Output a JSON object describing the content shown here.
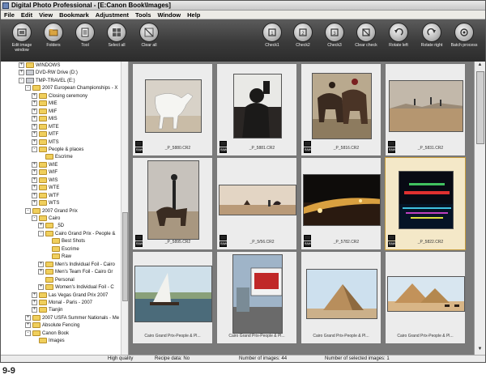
{
  "window": {
    "title": "Digital Photo Professional - [E:Canon Book\\Images]"
  },
  "menu": [
    "File",
    "Edit",
    "View",
    "Bookmark",
    "Adjustment",
    "Tools",
    "Window",
    "Help"
  ],
  "toolbar": {
    "left": [
      {
        "label": "Edit image window",
        "icon": "edit-image-icon"
      },
      {
        "label": "Folders",
        "icon": "folders-icon"
      },
      {
        "label": "Tool",
        "icon": "tool-icon"
      },
      {
        "label": "Select all",
        "icon": "select-all-icon"
      },
      {
        "label": "Clear all",
        "icon": "clear-all-icon"
      }
    ],
    "right": [
      {
        "label": "Check1",
        "icon": "check1-icon"
      },
      {
        "label": "Check2",
        "icon": "check2-icon"
      },
      {
        "label": "Check3",
        "icon": "check3-icon"
      },
      {
        "label": "Clear check",
        "icon": "clear-check-icon"
      },
      {
        "label": "Rotate left",
        "icon": "rotate-left-icon"
      },
      {
        "label": "Rotate right",
        "icon": "rotate-right-icon"
      },
      {
        "label": "Batch process",
        "icon": "batch-process-icon"
      }
    ]
  },
  "tree": [
    {
      "label": "WINDOWS",
      "exp": "+",
      "kind": "folder",
      "level": 1
    },
    {
      "label": "DVD-RW Drive (D:)",
      "exp": "+",
      "kind": "drive",
      "level": 1
    },
    {
      "label": "TMP-TRAVEL (E:)",
      "exp": "-",
      "kind": "drive",
      "level": 1
    },
    {
      "label": "2007 European Championships - X",
      "exp": "-",
      "kind": "folder",
      "level": 2
    },
    {
      "label": "Closing ceremony",
      "exp": "+",
      "kind": "folder",
      "level": 3
    },
    {
      "label": "MIE",
      "exp": "+",
      "kind": "folder",
      "level": 3
    },
    {
      "label": "MIF",
      "exp": "+",
      "kind": "folder",
      "level": 3
    },
    {
      "label": "MIS",
      "exp": "+",
      "kind": "folder",
      "level": 3
    },
    {
      "label": "MTE",
      "exp": "+",
      "kind": "folder",
      "level": 3
    },
    {
      "label": "MTF",
      "exp": "+",
      "kind": "folder",
      "level": 3
    },
    {
      "label": "MTS",
      "exp": "+",
      "kind": "folder",
      "level": 3
    },
    {
      "label": "People & places",
      "exp": "-",
      "kind": "folder",
      "level": 3
    },
    {
      "label": "Escrime",
      "exp": "",
      "kind": "folder",
      "level": 4
    },
    {
      "label": "WIE",
      "exp": "+",
      "kind": "folder",
      "level": 3
    },
    {
      "label": "WIF",
      "exp": "+",
      "kind": "folder",
      "level": 3
    },
    {
      "label": "WIS",
      "exp": "+",
      "kind": "folder",
      "level": 3
    },
    {
      "label": "WTE",
      "exp": "+",
      "kind": "folder",
      "level": 3
    },
    {
      "label": "WTF",
      "exp": "+",
      "kind": "folder",
      "level": 3
    },
    {
      "label": "WTS",
      "exp": "+",
      "kind": "folder",
      "level": 3
    },
    {
      "label": "2007 Grand Prix",
      "exp": "-",
      "kind": "folder",
      "level": 2
    },
    {
      "label": "Cairo",
      "exp": "-",
      "kind": "folder",
      "level": 3
    },
    {
      "label": "_5D",
      "exp": "+",
      "kind": "folder",
      "level": 4
    },
    {
      "label": "Cairo Grand Prix - People &",
      "exp": "-",
      "kind": "folder",
      "level": 4
    },
    {
      "label": "Best Shots",
      "exp": "",
      "kind": "folder",
      "level": 5
    },
    {
      "label": "Escrime",
      "exp": "",
      "kind": "folder",
      "level": 5
    },
    {
      "label": "Raw",
      "exp": "",
      "kind": "folder",
      "level": 5
    },
    {
      "label": "Men's Individual Foil - Cairo",
      "exp": "+",
      "kind": "folder",
      "level": 4
    },
    {
      "label": "Men's Team Foil - Cairo Gr",
      "exp": "+",
      "kind": "folder",
      "level": 4
    },
    {
      "label": "Personal",
      "exp": "",
      "kind": "folder",
      "level": 4
    },
    {
      "label": "Women's Individual Foil - C",
      "exp": "+",
      "kind": "folder",
      "level": 4
    },
    {
      "label": "Las Vegas Grand Prix 2007",
      "exp": "+",
      "kind": "folder",
      "level": 3
    },
    {
      "label": "Monal - Paris - 2007",
      "exp": "+",
      "kind": "folder",
      "level": 3
    },
    {
      "label": "Tianjin",
      "exp": "+",
      "kind": "folder",
      "level": 3
    },
    {
      "label": "2007 USFA Summer Nationals - Me",
      "exp": "+",
      "kind": "folder",
      "level": 2
    },
    {
      "label": "Absolute Fencing",
      "exp": "+",
      "kind": "folder",
      "level": 2
    },
    {
      "label": "Canon Book",
      "exp": "-",
      "kind": "folder",
      "level": 2
    },
    {
      "label": "Images",
      "exp": "",
      "kind": "folder",
      "level": 3
    }
  ],
  "thumbnails": [
    {
      "name": "_P_5880.CR2",
      "scene": "white-horse",
      "selected": false,
      "raw": true
    },
    {
      "name": "_P_5881.CR2",
      "scene": "silhouette-kettle",
      "selected": false,
      "raw": true
    },
    {
      "name": "_P_5816.CR2",
      "scene": "horses-riders",
      "selected": false,
      "raw": true
    },
    {
      "name": "_P_5831.CR2",
      "scene": "desert-riders",
      "selected": false,
      "raw": true
    },
    {
      "name": "_P_5895.CR2",
      "scene": "acrobat-camel",
      "selected": false,
      "raw": true
    },
    {
      "name": "_P_5/56.CR2",
      "scene": "desert-horizon",
      "selected": false,
      "raw": true
    },
    {
      "name": "_P_5782.CR2",
      "scene": "night-car",
      "selected": false,
      "raw": true
    },
    {
      "name": "_P_5822.CR2",
      "scene": "night-lights",
      "selected": true,
      "raw": true
    },
    {
      "name": "Cairo Grand Prix-People & Pl...",
      "scene": "felucca",
      "selected": false,
      "raw": false
    },
    {
      "name": "Cairo Grand Prix-People & Pl...",
      "scene": "billboard",
      "selected": false,
      "raw": false
    },
    {
      "name": "Cairo Grand Prix-People & Pl...",
      "scene": "pyramid",
      "selected": false,
      "raw": false
    },
    {
      "name": "Cairo Grand Prix-People & Pl...",
      "scene": "pyramids-camels",
      "selected": false,
      "raw": false
    }
  ],
  "status": {
    "quality": "High quality",
    "recipe": "Recipe data: No",
    "count": "Number of images: 44",
    "selected": "Number of selected images: 1"
  },
  "caption": "9-9",
  "colors": {
    "toolbar_bg": "#3a3a3a",
    "selected_cell": "#f4e8c8",
    "panel_bg": "#7a7a7a",
    "folder": "#f0cf5c"
  }
}
